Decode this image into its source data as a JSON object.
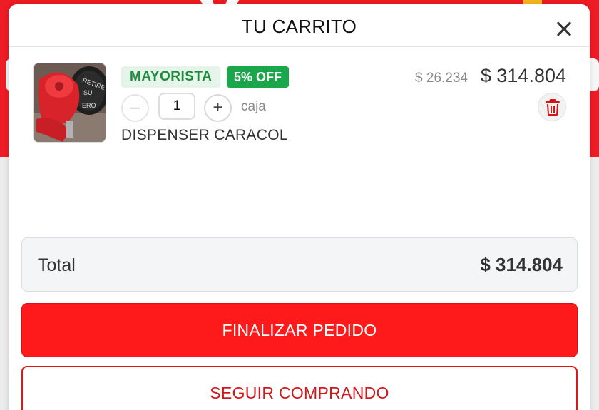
{
  "cart": {
    "title": "TU CARRITO",
    "close_icon": "close-icon"
  },
  "item": {
    "badge_type": "MAYORISTA",
    "badge_discount": "5% OFF",
    "quantity": "1",
    "unit": "caja",
    "name": "DISPENSER CARACOL",
    "unit_price": "$ 26.234",
    "total_price": "$ 314.804",
    "qty_minus_label": "–",
    "qty_plus_label": "+",
    "delete_icon": "trash-icon"
  },
  "summary": {
    "total_label": "Total",
    "total_value": "$ 314.804"
  },
  "actions": {
    "checkout_label": "FINALIZAR PEDIDO",
    "continue_label": "SEGUIR COMPRANDO"
  },
  "colors": {
    "brand_red": "#ee1c24",
    "badge_green": "#1aa64a",
    "badge_green_light": "#e6f5ea",
    "delete_red": "#d01818"
  }
}
